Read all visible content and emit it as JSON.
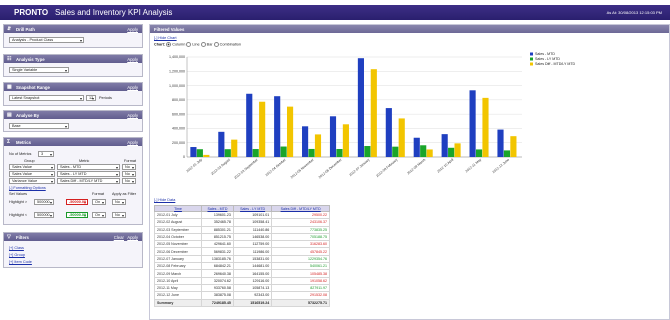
{
  "app": {
    "logo": "PRONTO",
    "title": "Sales and Inventory KPI Analysis",
    "as_at": "As At: 30/08/2013 12:15:03 PM"
  },
  "colors": {
    "header": "#2a1f6e",
    "series1": "#1f3fc0",
    "series2": "#1aa52a",
    "series3": "#f2c500"
  },
  "panels": {
    "drill": {
      "title": "Drill Path",
      "apply": "Apply",
      "value": "Analysis - Product Class",
      "icon": "drill-icon"
    },
    "analysis": {
      "title": "Analysis Type",
      "apply": "Apply",
      "value": "Single Variable",
      "icon": "analysis-icon"
    },
    "snapshot": {
      "title": "Snapshot Range",
      "apply": "Apply",
      "value": "Latest Snapshot",
      "periods": "12",
      "periods_label": "Periods",
      "icon": "calendar-icon"
    },
    "analyse": {
      "title": "Analyse By",
      "apply": "Apply",
      "value": "Base",
      "icon": "analyse-icon"
    },
    "metrics": {
      "title": "Metrics",
      "apply": "Apply",
      "count_label": "No of Metrics",
      "count": "3",
      "col_group": "Group",
      "col_metric": "Metric",
      "col_format": "Format",
      "rows": [
        {
          "group": "Sales Value",
          "metric": "Sales - MTD",
          "format": "No"
        },
        {
          "group": "Sales Value",
          "metric": "Sales - LY MTD",
          "format": "No"
        },
        {
          "group": "Variance Value",
          "metric": "Sales Diff - MTD/LY MTD",
          "format": "No"
        }
      ],
      "formatting_label": "[-] Formatting Options",
      "set_values": "Set Values",
      "format": "Format",
      "apply_filter": "Apply as Filter",
      "highlight1": {
        "label": "Highlight >",
        "v1": "500000",
        "v2": "-50000.00",
        "f": "On",
        "a": "No"
      },
      "highlight2": {
        "label": "Highlight <",
        "v1": "500000",
        "v2": "-50000.00",
        "f": "On",
        "a": "No"
      }
    },
    "filters": {
      "title": "Filters",
      "clear": "Clear",
      "apply": "Apply",
      "items": [
        "[+] Class",
        "[+] Group",
        "[+] Item Code"
      ]
    }
  },
  "main": {
    "title": "Filtered Values",
    "hide_chart": "[-] Hide Chart",
    "chart_label": "Chart:",
    "chart_types": [
      "Column",
      "Line",
      "Bar",
      "Combination"
    ],
    "selected_chart": "Column",
    "hide_data": "[-] Hide Data"
  },
  "chart_data": {
    "type": "bar",
    "categories": [
      "2012-01 July",
      "2012-02 August",
      "2012-03 September",
      "2012-04 October",
      "2012-05 November",
      "2012-06 December",
      "2012-07 January",
      "2012-08 February",
      "2012-09 March",
      "2012-10 April",
      "2012-11 May",
      "2012-12 June"
    ],
    "series": [
      {
        "name": "Sales - MTD",
        "values": [
          139601,
          352465,
          885301,
          851215,
          429641,
          569831,
          1383185,
          684842,
          269640,
          320074,
          933760,
          383875
        ]
      },
      {
        "name": "Sales - LY MTD",
        "values": [
          109101,
          109359,
          111440,
          146539,
          112759,
          111986,
          153831,
          144681,
          164155,
          129116,
          105874,
          92343
        ]
      },
      {
        "name": "Sales Diff - MTD/LY MTD",
        "values": [
          29500,
          243106,
          773835,
          705188,
          316283,
          457845,
          1229354,
          540061,
          105485,
          191059,
          827911,
          291532
        ]
      }
    ],
    "ylim": [
      0,
      1400000
    ],
    "yticks": [
      "0",
      "200,000",
      "400,000",
      "600,000",
      "800,000",
      "1,000,000",
      "1,200,000",
      "1,400,000"
    ],
    "legend": "top-right"
  },
  "table": {
    "headers": [
      "Time",
      "Sales - MTD",
      "Sales - LY MTD",
      "Sales Diff - MTD/LY MTD"
    ],
    "rows": [
      [
        "2012-01 July",
        "139601.23",
        "109101.01",
        "29500.22"
      ],
      [
        "2012-02 August",
        "352465.78",
        "109358.41",
        "243106.37"
      ],
      [
        "2012-03 September",
        "885301.21",
        "111440.86",
        "773835.25"
      ],
      [
        "2012-04 October",
        "851215.75",
        "146538.00",
        "705188.75"
      ],
      [
        "2012-05 November",
        "429641.60",
        "112759.00",
        "316283.60"
      ],
      [
        "2012-06 December",
        "569831.22",
        "111986.00",
        "457845.22"
      ],
      [
        "2012-07 January",
        "1383185.76",
        "153831.00",
        "1229354.76"
      ],
      [
        "2012-08 February",
        "684842.21",
        "144681.00",
        "540061.21"
      ],
      [
        "2012-09 March",
        "269640.38",
        "164155.00",
        "105485.38"
      ],
      [
        "2012-10 April",
        "320074.62",
        "129116.00",
        "191058.62"
      ],
      [
        "2012-11 May",
        "933760.58",
        "105874.13",
        "827911.97"
      ],
      [
        "2012-12 June",
        "383875.08",
        "92343.00",
        "291532.08"
      ]
    ],
    "row_classes": [
      "neg",
      "neg",
      "pos",
      "pos",
      "neg",
      "neg",
      "pos",
      "pos",
      "neg",
      "neg",
      "pos",
      "neg"
    ],
    "summary": [
      "Summary",
      "7249185.45",
      "1516519.24",
      "5732275.71"
    ]
  }
}
